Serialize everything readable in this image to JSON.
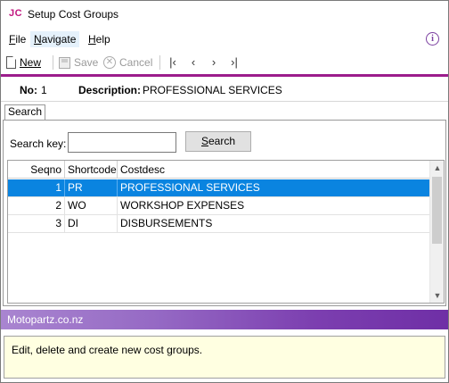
{
  "window": {
    "logo": "JC",
    "title": "Setup Cost Groups"
  },
  "menu": {
    "items": [
      {
        "label": "File",
        "accel": "F",
        "rest": "ile"
      },
      {
        "label": "Navigate",
        "accel": "N",
        "rest": "avigate"
      },
      {
        "label": "Help",
        "accel": "H",
        "rest": "elp"
      }
    ],
    "info_icon": "i"
  },
  "toolbar": {
    "new_label": "New",
    "save_label": "Save",
    "cancel_label": "Cancel",
    "nav": {
      "first": "|‹",
      "prev": "‹",
      "next": "›",
      "last": "›|"
    }
  },
  "record": {
    "no_label": "No:",
    "no_value": "1",
    "description_label": "Description:",
    "description_value": "PROFESSIONAL SERVICES"
  },
  "tabs": {
    "search_tab": "Search"
  },
  "search": {
    "label": "Search key:",
    "value": "",
    "placeholder": "",
    "button_accel": "S",
    "button_rest": "earch"
  },
  "grid": {
    "columns": [
      "Seqno",
      "Shortcode",
      "Costdesc"
    ],
    "rows": [
      {
        "seqno": "1",
        "shortcode": "PR",
        "costdesc": "PROFESSIONAL SERVICES",
        "selected": true
      },
      {
        "seqno": "2",
        "shortcode": "WO",
        "costdesc": "WORKSHOP EXPENSES",
        "selected": false
      },
      {
        "seqno": "3",
        "shortcode": "DI",
        "costdesc": "DISBURSEMENTS",
        "selected": false
      }
    ]
  },
  "status_bar": {
    "text": "Motopartz.co.nz"
  },
  "help": {
    "text": "Edit, delete and create new cost groups."
  },
  "colors": {
    "accent": "#9c1d8c",
    "selection": "#0a84e0",
    "status_bar": "#7c3fb0",
    "help_background": "#ffffe1"
  }
}
